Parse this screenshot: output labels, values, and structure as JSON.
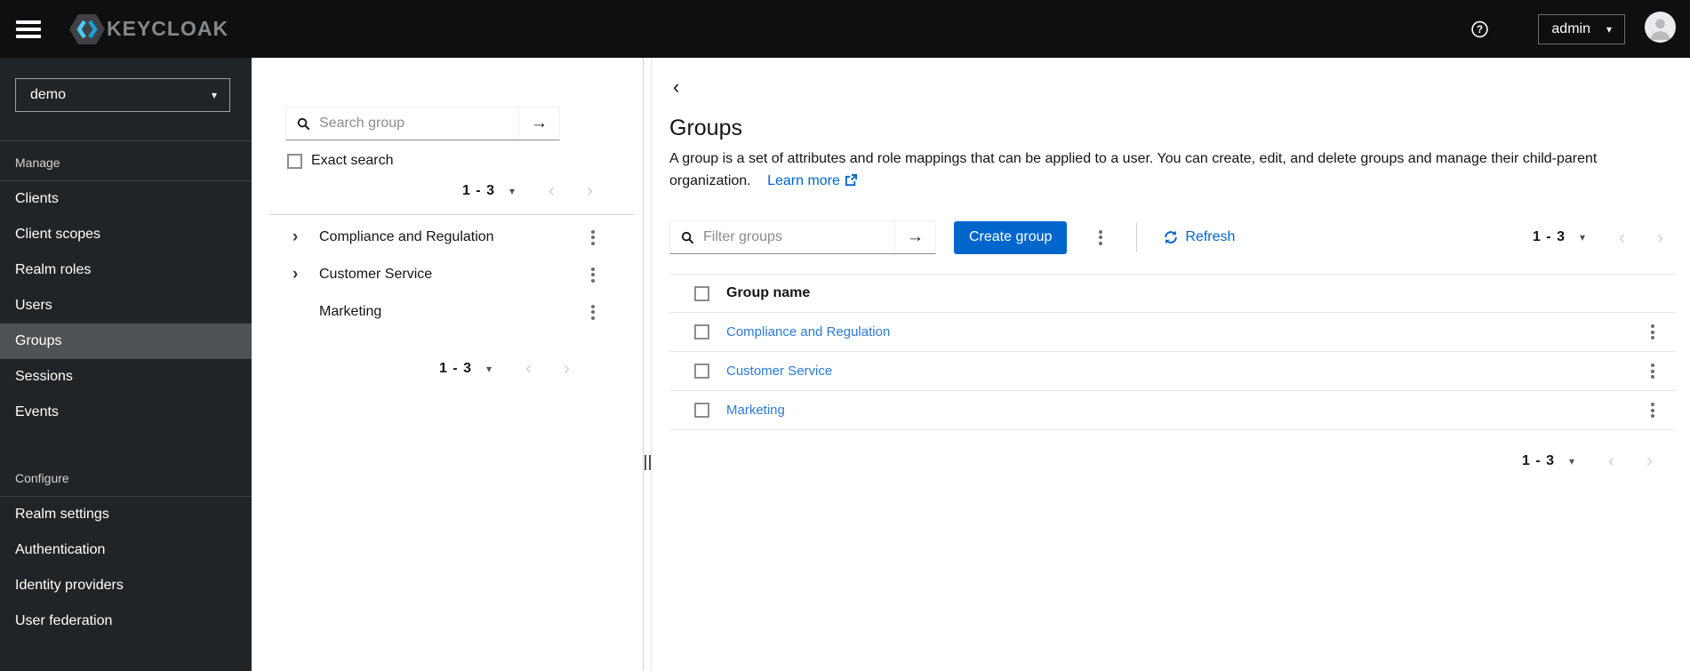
{
  "colors": {
    "accent": "#0066cc",
    "masthead_bg": "#0e0f10",
    "sidebar_bg": "#212427",
    "sidebar_active_bg": "#4f5255",
    "link": "#0066cc",
    "table_link": "#2b7bd6"
  },
  "icons": {
    "hamburger": "three-bars",
    "help": "question-circle",
    "search": "magnifier",
    "arrow_right": "→",
    "caret_down": "▾",
    "kebab": "vertical-dots",
    "chevron_left": "‹",
    "chevron_right": "›",
    "tree_expand": "›",
    "back": "‹",
    "refresh": "sync-arrows",
    "external_link": "box-arrow",
    "avatar": "person-circle"
  },
  "header": {
    "brand": "KEYCLOAK",
    "username": "admin"
  },
  "sidebar": {
    "realm": "demo",
    "sections": [
      {
        "title": "Manage",
        "active_item": "Groups",
        "items": [
          "Clients",
          "Client scopes",
          "Realm roles",
          "Users",
          "Groups",
          "Sessions",
          "Events"
        ]
      },
      {
        "title": "Configure",
        "items": [
          "Realm settings",
          "Authentication",
          "Identity providers",
          "User federation"
        ]
      }
    ]
  },
  "tree_panel": {
    "search_placeholder": "Search group",
    "exact_search_label": "Exact search",
    "pagination_top": "1 - 3",
    "pagination_bottom": "1 - 3",
    "items": [
      {
        "label": "Compliance and Regulation",
        "expandable": true
      },
      {
        "label": "Customer Service",
        "expandable": true
      },
      {
        "label": "Marketing",
        "expandable": false
      }
    ]
  },
  "main": {
    "title": "Groups",
    "description": "A group is a set of attributes and role mappings that can be applied to a user. You can create, edit, and delete groups and manage their child-parent organization.",
    "learn_more_label": "Learn more",
    "toolbar": {
      "filter_placeholder": "Filter groups",
      "create_button_label": "Create group",
      "refresh_label": "Refresh",
      "pagination": "1 - 3"
    },
    "table": {
      "column_header": "Group name",
      "rows": [
        "Compliance and Regulation",
        "Customer Service",
        "Marketing"
      ]
    },
    "pagination_bottom": "1 - 3"
  }
}
